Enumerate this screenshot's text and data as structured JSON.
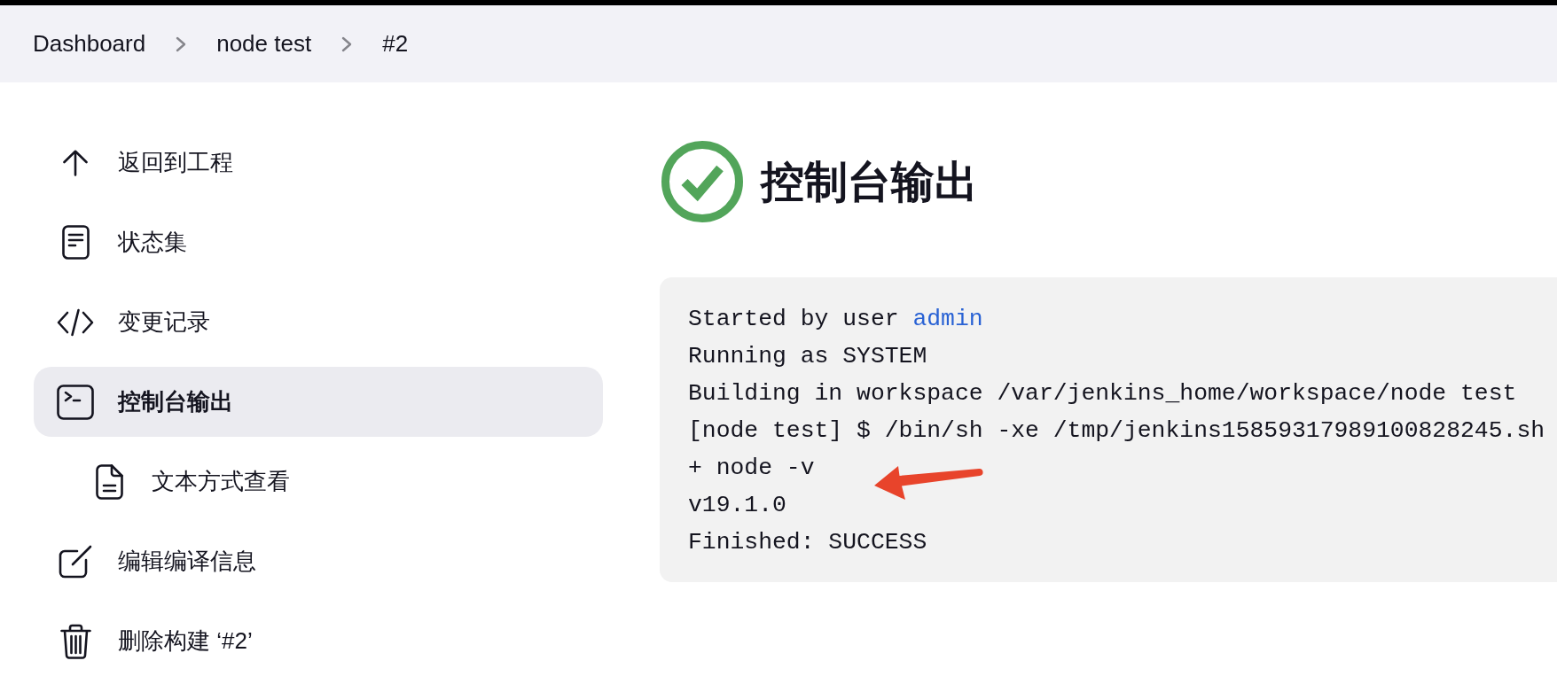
{
  "breadcrumbs": [
    "Dashboard",
    "node test",
    "#2"
  ],
  "sidebar": {
    "items": [
      {
        "label": "返回到工程",
        "selected": false
      },
      {
        "label": "状态集",
        "selected": false
      },
      {
        "label": "变更记录",
        "selected": false
      },
      {
        "label": "控制台输出",
        "selected": true,
        "children": [
          {
            "label": "文本方式查看",
            "selected": false
          }
        ]
      },
      {
        "label": "编辑编译信息",
        "selected": false
      },
      {
        "label": "删除构建 ‘#2’",
        "selected": false
      }
    ]
  },
  "heading": {
    "title": "控制台输出",
    "succeeded": true
  },
  "console": {
    "lines": [
      {
        "text": "Started by user ",
        "link": "admin"
      },
      {
        "text": "Running as SYSTEM"
      },
      {
        "text": "Building in workspace /var/jenkins_home/workspace/node test"
      },
      {
        "text": "[node test] $ /bin/sh -xe /tmp/jenkins15859317989100828245.sh"
      },
      {
        "text": "+ node -v"
      },
      {
        "text": "v19.1.0"
      },
      {
        "text": "Finished: SUCCESS"
      }
    ],
    "annotations": [
      {
        "kind": "arrow"
      }
    ]
  }
}
